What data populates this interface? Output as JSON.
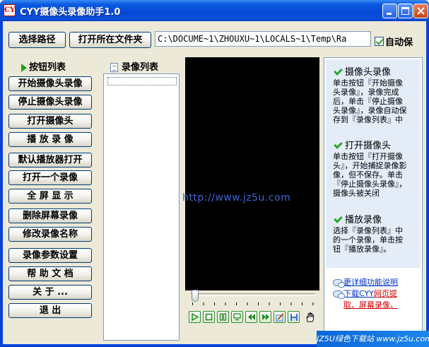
{
  "window": {
    "title": "CYY摄像头录像助手1.0",
    "icon_label": "CY"
  },
  "toolbar": {
    "choose_path_label": "选择路径",
    "open_folder_label": "打开所在文件夹",
    "path_value": "C:\\DOCUME~1\\ZHOUXU~1\\LOCALS~1\\Temp\\Ra",
    "autosave_label": "自动保",
    "autosave_checked": true
  },
  "sections": {
    "buttons_header": "按钮列表",
    "recordings_header": "录像列表"
  },
  "buttons": [
    "开始摄像头录像",
    "停止摄像头录像",
    "打开摄像头",
    "播 放 录 像",
    "默认播放器打开",
    "打开一个录像",
    "全 屏 显 示",
    "删除屏幕录像",
    "修改录像名称",
    "录像参数设置",
    "帮 助 文 档",
    "关 于 ...",
    "退  出"
  ],
  "video": {
    "overlay_url": "http://www.jz5u.com"
  },
  "player_controls": [
    {
      "name": "play-icon",
      "glyph": "▷"
    },
    {
      "name": "stop-icon",
      "glyph": "□"
    },
    {
      "name": "pause-icon",
      "glyph": "Ⅱ"
    },
    {
      "name": "monitor-icon",
      "glyph": "▭"
    },
    {
      "name": "rewind-icon",
      "glyph": "◀◀"
    },
    {
      "name": "fast-forward-icon",
      "glyph": "▶▶"
    },
    {
      "name": "snapshot-icon",
      "glyph": "✎"
    },
    {
      "name": "save-icon",
      "glyph": "▤"
    },
    {
      "name": "hand-icon",
      "glyph": "✋"
    }
  ],
  "help": {
    "sections": [
      {
        "title": "摄像头录像",
        "text": "单击按钮『开始摄像头录像』，录像完成后，单击『停止摄像头录像』，录像自动保存到『录像列表』中"
      },
      {
        "title": "打开摄像头",
        "text": "单击按钮『打开摄像头』，开始捕捉录像影像，但不保存。单击『停止摄像头录像』，摄像头被关闭"
      },
      {
        "title": "播放录像",
        "text": "选择『录像列表』中的一个录像，单击按钮『播放录像』。"
      }
    ],
    "link_details": "更详细功能说明",
    "link_download_prefix": "下载CYY",
    "link_download_red1": "网页提",
    "link_download_red2": "取、屏幕录像、"
  },
  "branding": {
    "corner_logo": "JZ5U绿色下载站 www.jz5u.com"
  },
  "colors": {
    "titlebar": "#0548d6",
    "client_bg": "#ece9d8",
    "video_bg": "#000000",
    "help_bg": "#e4ecf8",
    "link_red": "#d40000"
  }
}
